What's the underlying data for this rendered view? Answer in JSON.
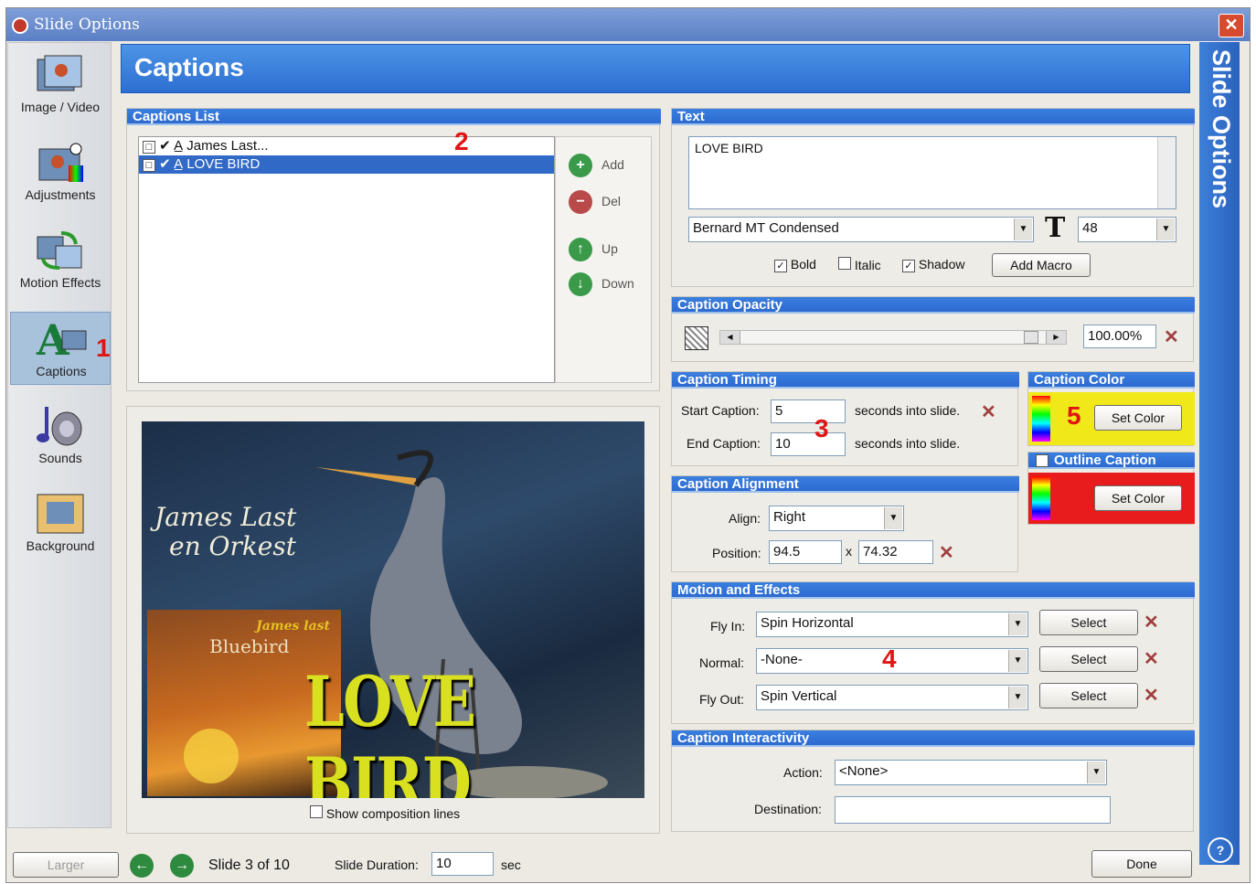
{
  "window": {
    "title": "Slide Options",
    "close_label": "✕"
  },
  "sidebar": {
    "items": [
      {
        "label": "Image / Video"
      },
      {
        "label": "Adjustments"
      },
      {
        "label": "Motion Effects"
      },
      {
        "label": "Captions"
      },
      {
        "label": "Sounds"
      },
      {
        "label": "Background"
      }
    ]
  },
  "header": {
    "title": "Captions"
  },
  "right_bar": {
    "title": "Slide Options",
    "help": "?"
  },
  "captions_list": {
    "header": "Captions List",
    "items": [
      {
        "label": "James Last..."
      },
      {
        "label": "LOVE BIRD",
        "selected": true
      }
    ],
    "buttons": {
      "add": "Add",
      "del": "Del",
      "up": "Up",
      "down": "Down"
    }
  },
  "preview": {
    "title1": "James Last",
    "title2": "en Orkest",
    "album_brand": "James last",
    "album_title": "Bluebird",
    "caption": "LOVE BIRD",
    "show_lines_label": "Show composition lines"
  },
  "text": {
    "header": "Text",
    "value": "LOVE BIRD",
    "font": "Bernard MT Condensed",
    "size": "48",
    "bold_label": "Bold",
    "italic_label": "Italic",
    "shadow_label": "Shadow",
    "bold": true,
    "italic": false,
    "shadow": true,
    "macro_label": "Add Macro"
  },
  "opacity": {
    "header": "Caption Opacity",
    "value": "100.00%"
  },
  "timing": {
    "header": "Caption Timing",
    "start_label": "Start Caption:",
    "start_value": "5",
    "end_label": "End Caption:",
    "end_value": "10",
    "suffix": "seconds into slide."
  },
  "color": {
    "header": "Caption Color",
    "set_label": "Set Color",
    "swatch": "#f0e818"
  },
  "outline": {
    "header": "Outline Caption",
    "set_label": "Set Color",
    "swatch": "#e81c1c"
  },
  "alignment": {
    "header": "Caption Alignment",
    "align_label": "Align:",
    "align_value": "Right",
    "position_label": "Position:",
    "x": "94.5",
    "sep": "x",
    "y": "74.32"
  },
  "motion": {
    "header": "Motion and Effects",
    "rows": [
      {
        "label": "Fly In:",
        "value": "Spin Horizontal",
        "button": "Select"
      },
      {
        "label": "Normal:",
        "value": "-None-",
        "button": "Select"
      },
      {
        "label": "Fly Out:",
        "value": "Spin Vertical",
        "button": "Select"
      }
    ]
  },
  "interactivity": {
    "header": "Caption Interactivity",
    "action_label": "Action:",
    "action_value": "<None>",
    "destination_label": "Destination:",
    "destination_value": ""
  },
  "footer": {
    "larger": "Larger",
    "slide_text": "Slide 3 of 10",
    "duration_label": "Slide Duration:",
    "duration_value": "10",
    "unit": "sec",
    "done": "Done"
  },
  "annotations": {
    "m1": "1",
    "m2": "2",
    "m3": "3",
    "m4": "4",
    "m5": "5"
  }
}
